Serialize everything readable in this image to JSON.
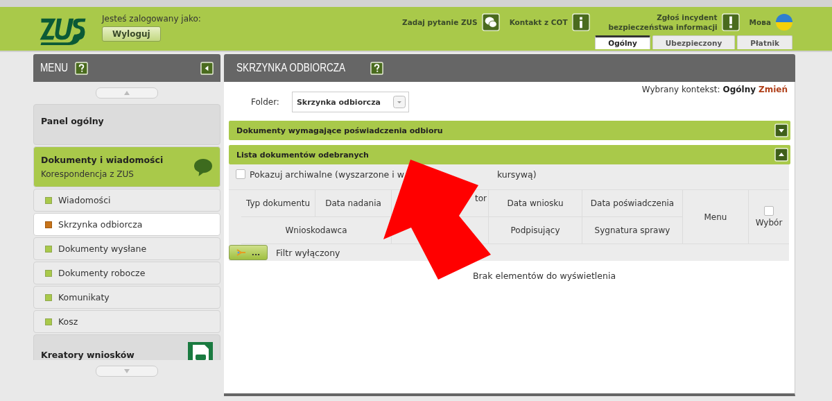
{
  "header": {
    "logged_in_label": "Jesteś zalogowany jako:",
    "logout_button": "Wyloguj",
    "links": [
      {
        "label": "Zadaj pytanie ZUS",
        "kind": "chat"
      },
      {
        "label": "Kontakt z COT",
        "kind": "info"
      },
      {
        "label": "Zgłoś incydent bezpieczeństwa informacji",
        "kind": "alert"
      }
    ],
    "language": "Мова",
    "tabs": [
      {
        "label": "Ogólny",
        "selected": true
      },
      {
        "label": "Ubezpieczony",
        "selected": false
      },
      {
        "label": "Płatnik",
        "selected": false
      }
    ]
  },
  "sidebar": {
    "title": "MENU",
    "groups": [
      {
        "title": "Panel ogólny",
        "selected": false
      },
      {
        "title": "Dokumenty i wiadomości",
        "subtitle": "Korespondencja z ZUS",
        "selected": true,
        "kind": "chat",
        "children": [
          {
            "label": "Wiadomości",
            "selected": false
          },
          {
            "label": "Skrzynka odbiorcza",
            "selected": true
          },
          {
            "label": "Dokumenty wysłane",
            "selected": false
          },
          {
            "label": "Dokumenty robocze",
            "selected": false
          },
          {
            "label": "Komunikaty",
            "selected": false
          },
          {
            "label": "Kosz",
            "selected": false
          }
        ]
      },
      {
        "title": "Kreatory wniosków",
        "selected": false,
        "kind": "form"
      }
    ]
  },
  "main": {
    "title": "SKRZYNKA ODBIORCZA",
    "context_label": "Wybrany kontekst:",
    "context_value": "Ogólny",
    "context_change": "Zmień",
    "folder_label": "Folder:",
    "folder_value": "Skrzynka odbiorcza",
    "sections": [
      {
        "title": "Dokumenty wymagające poświadczenia odbioru",
        "expanded": false
      },
      {
        "title": "Lista dokumentów odebranych",
        "expanded": true
      }
    ],
    "archive_checkbox": {
      "label_parts": [
        "Pokazuj archiwalne (wyszarzone i w",
        "kursywą)"
      ],
      "checked": false
    },
    "table": {
      "header_row_1": [
        "Typ dokumentu",
        "Data nadania",
        "tor",
        "Data wniosku",
        "Data poświadczenia"
      ],
      "header_row_2": [
        "Wnioskodawca",
        "Podpisujący",
        "Sygnatura sprawy"
      ],
      "menu_column": "Menu",
      "select_column": {
        "label": "Wybór",
        "checked": false
      }
    },
    "filter_button": "...",
    "filter_status": "Filtr wyłączony",
    "empty_message": "Brak elementów do wyświetlenia"
  }
}
